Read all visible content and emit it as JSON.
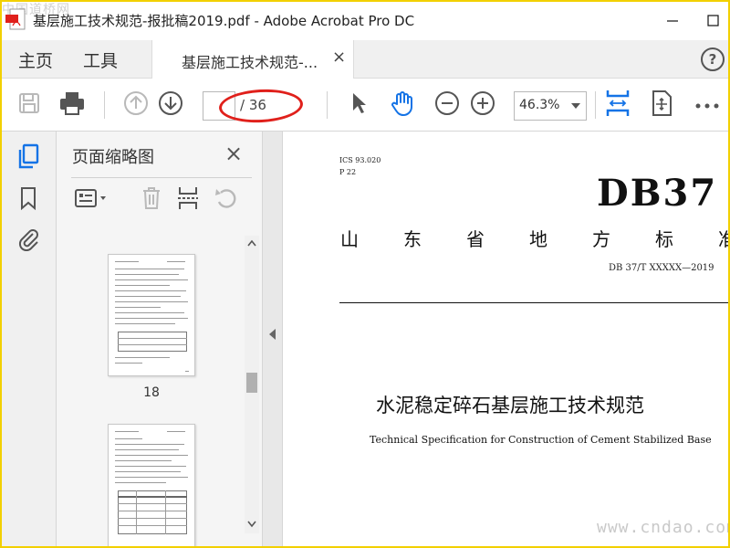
{
  "watermark_top": "中国道桥网",
  "window": {
    "title": "基层施工技术规范-报批稿2019.pdf - Adobe Acrobat Pro DC"
  },
  "tabs": {
    "home": "主页",
    "tools": "工具",
    "document": "基层施工技术规范-...",
    "close": "×",
    "help": "?"
  },
  "toolbar": {
    "page_current": "",
    "page_total": "/ 36",
    "zoom": "46.3%"
  },
  "panel": {
    "title": "页面缩略图",
    "close": "×",
    "pages": [
      "18"
    ]
  },
  "document": {
    "ics": "ICS  93.020",
    "p": "P  22",
    "db_code": "DB37",
    "province_chars": [
      "山",
      "东",
      "省",
      "地",
      "方",
      "标",
      "准"
    ],
    "standard_no": "DB 37/T  XXXXX—2019",
    "title_cn": "水泥稳定碎石基层施工技术规范",
    "title_en": "Technical Specification for Construction of Cement Stabilized Base"
  },
  "watermark_bottom": "www.cndao.com",
  "colors": {
    "accent_blue": "#1473e6",
    "annotation_red": "#e0201b",
    "frame_yellow": "#f2d000"
  }
}
